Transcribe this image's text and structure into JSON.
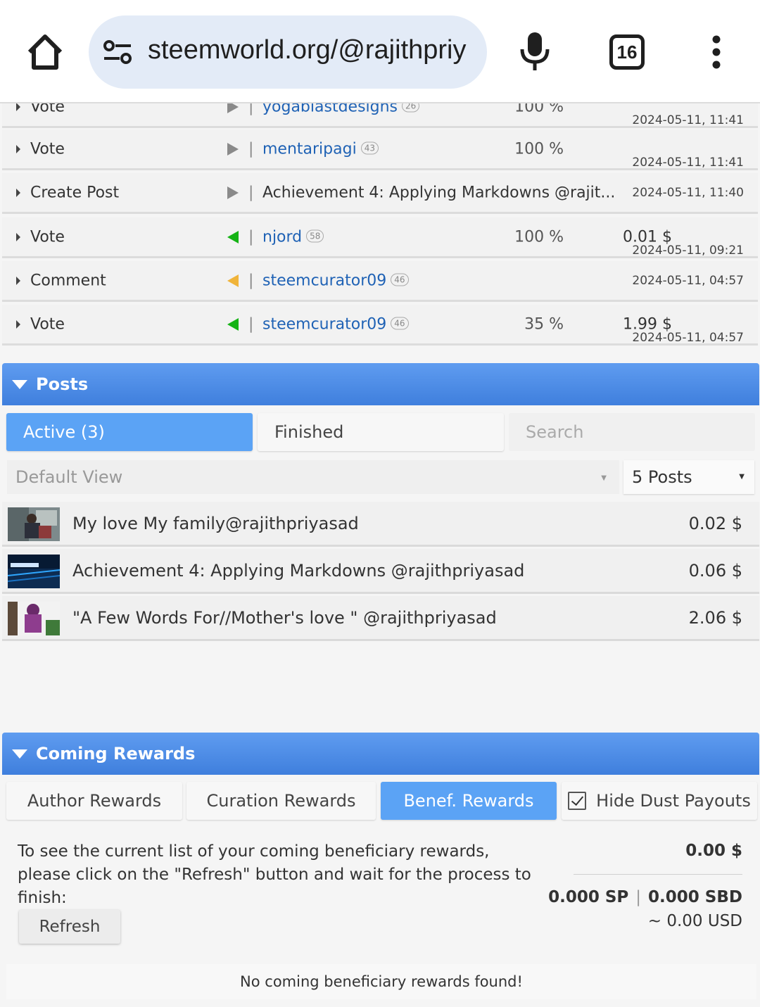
{
  "browser": {
    "url": "steemworld.org/@rajithpriy",
    "tab_count": "16"
  },
  "activity": [
    {
      "type": "Vote",
      "direction": "out",
      "who": "yogablastdesigns",
      "rep": "26",
      "pct": "100 %",
      "amount": "",
      "time": "2024-05-11, 11:41"
    },
    {
      "type": "Vote",
      "direction": "out",
      "who": "mentaripagi",
      "rep": "43",
      "pct": "100 %",
      "amount": "",
      "time": "2024-05-11, 11:41"
    },
    {
      "type": "Create Post",
      "direction": "out",
      "who": "Achievement 4: Applying Markdowns @rajit...",
      "rep": "",
      "pct": "",
      "amount": "",
      "time": "2024-05-11, 11:40"
    },
    {
      "type": "Vote",
      "direction": "in-green",
      "who": "njord",
      "rep": "58",
      "pct": "100 %",
      "amount": "0.01 $",
      "time": "2024-05-11, 09:21"
    },
    {
      "type": "Comment",
      "direction": "in-orange",
      "who": "steemcurator09",
      "rep": "46",
      "pct": "",
      "amount": "",
      "time": "2024-05-11, 04:57"
    },
    {
      "type": "Vote",
      "direction": "in-green",
      "who": "steemcurator09",
      "rep": "46",
      "pct": "35 %",
      "amount": "1.99 $",
      "time": "2024-05-11, 04:57"
    }
  ],
  "posts_section": {
    "title": "Posts",
    "tabs": [
      "Active (3)",
      "Finished",
      "Search"
    ],
    "view_select": "Default View",
    "count_select": "5 Posts",
    "items": [
      {
        "title": "My love My family@rajithpriyasad",
        "amount": "0.02 $"
      },
      {
        "title": "Achievement 4: Applying Markdowns @rajithpriyasad",
        "amount": "0.06 $"
      },
      {
        "title": "\"A Few Words For//Mother's love \" @rajithpriyasad",
        "amount": "2.06 $"
      }
    ]
  },
  "rewards_section": {
    "title": "Coming Rewards",
    "tabs": [
      "Author Rewards",
      "Curation Rewards",
      "Benef. Rewards"
    ],
    "hide_dust": "Hide Dust Payouts",
    "info_line1": "To see the current list of your coming beneficiary rewards,",
    "info_line2": "please click on the \"Refresh\" button and wait for the process to finish:",
    "total": "0.00 $",
    "sp": "0.000 SP",
    "sbd": "0.000 SBD",
    "usd": "~ 0.00 USD",
    "refresh_label": "Refresh",
    "empty_msg": "No coming beneficiary rewards found!"
  }
}
